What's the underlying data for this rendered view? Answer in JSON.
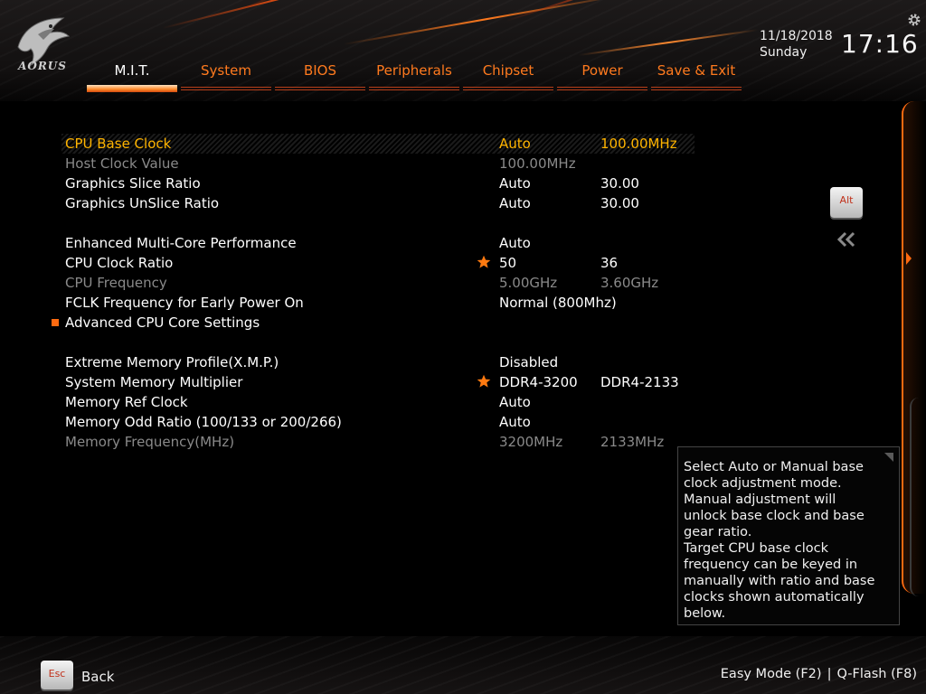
{
  "header": {
    "brand": "AORUS",
    "date": "11/18/2018",
    "day": "Sunday",
    "time": "17:16",
    "tabs": [
      {
        "label": "M.I.T.",
        "active": true
      },
      {
        "label": "System"
      },
      {
        "label": "BIOS"
      },
      {
        "label": "Peripherals"
      },
      {
        "label": "Chipset"
      },
      {
        "label": "Power"
      },
      {
        "label": "Save & Exit"
      }
    ]
  },
  "settings": [
    {
      "label": "CPU Base Clock",
      "value1": "Auto",
      "value2": "100.00MHz",
      "state": "selected"
    },
    {
      "label": "Host Clock Value",
      "value1": "100.00MHz",
      "value2": "",
      "state": "disabled"
    },
    {
      "label": "Graphics Slice Ratio",
      "value1": "Auto",
      "value2": "30.00",
      "state": "normal"
    },
    {
      "label": "Graphics UnSlice Ratio",
      "value1": "Auto",
      "value2": "30.00",
      "state": "normal"
    },
    {
      "label": "Enhanced Multi-Core Performance",
      "value1": "Auto",
      "value2": "",
      "state": "normal"
    },
    {
      "label": "CPU Clock Ratio",
      "value1": "50",
      "value2": "36",
      "state": "normal",
      "starred": true
    },
    {
      "label": "CPU Frequency",
      "value1": "5.00GHz",
      "value2": "3.60GHz",
      "state": "disabled"
    },
    {
      "label": "FCLK Frequency for Early Power On",
      "value1": "Normal (800Mhz)",
      "value2": "",
      "state": "normal"
    },
    {
      "label": "Advanced CPU Core Settings",
      "value1": "",
      "value2": "",
      "state": "submenu"
    },
    {
      "label": "Extreme Memory Profile(X.M.P.)",
      "value1": "Disabled",
      "value2": "",
      "state": "normal"
    },
    {
      "label": "System Memory Multiplier",
      "value1": "DDR4-3200",
      "value2": "DDR4-2133",
      "state": "normal",
      "starred": true
    },
    {
      "label": "Memory Ref Clock",
      "value1": "Auto",
      "value2": "",
      "state": "normal"
    },
    {
      "label": "Memory Odd Ratio (100/133 or 200/266)",
      "value1": "Auto",
      "value2": "",
      "state": "normal"
    },
    {
      "label": "Memory Frequency(MHz)",
      "value1": "3200MHz",
      "value2": "2133MHz",
      "state": "disabled"
    }
  ],
  "side": {
    "alt_label": "Alt"
  },
  "help": {
    "text": "Select Auto or Manual base\nclock adjustment mode.\nManual adjustment will\nunlock base clock and base\ngear ratio.\nTarget CPU base clock\nfrequency can be keyed in\nmanually with ratio and base\nclocks shown automatically\nbelow."
  },
  "footer": {
    "esc_label": "Esc",
    "back_label": "Back",
    "easy_mode": "Easy Mode (F2)",
    "separator": "|",
    "qflash": "Q-Flash (F8)"
  },
  "colors": {
    "accent": "#ff7a1e",
    "selected_text": "#ffb400",
    "disabled_text": "#8a8a8a"
  }
}
